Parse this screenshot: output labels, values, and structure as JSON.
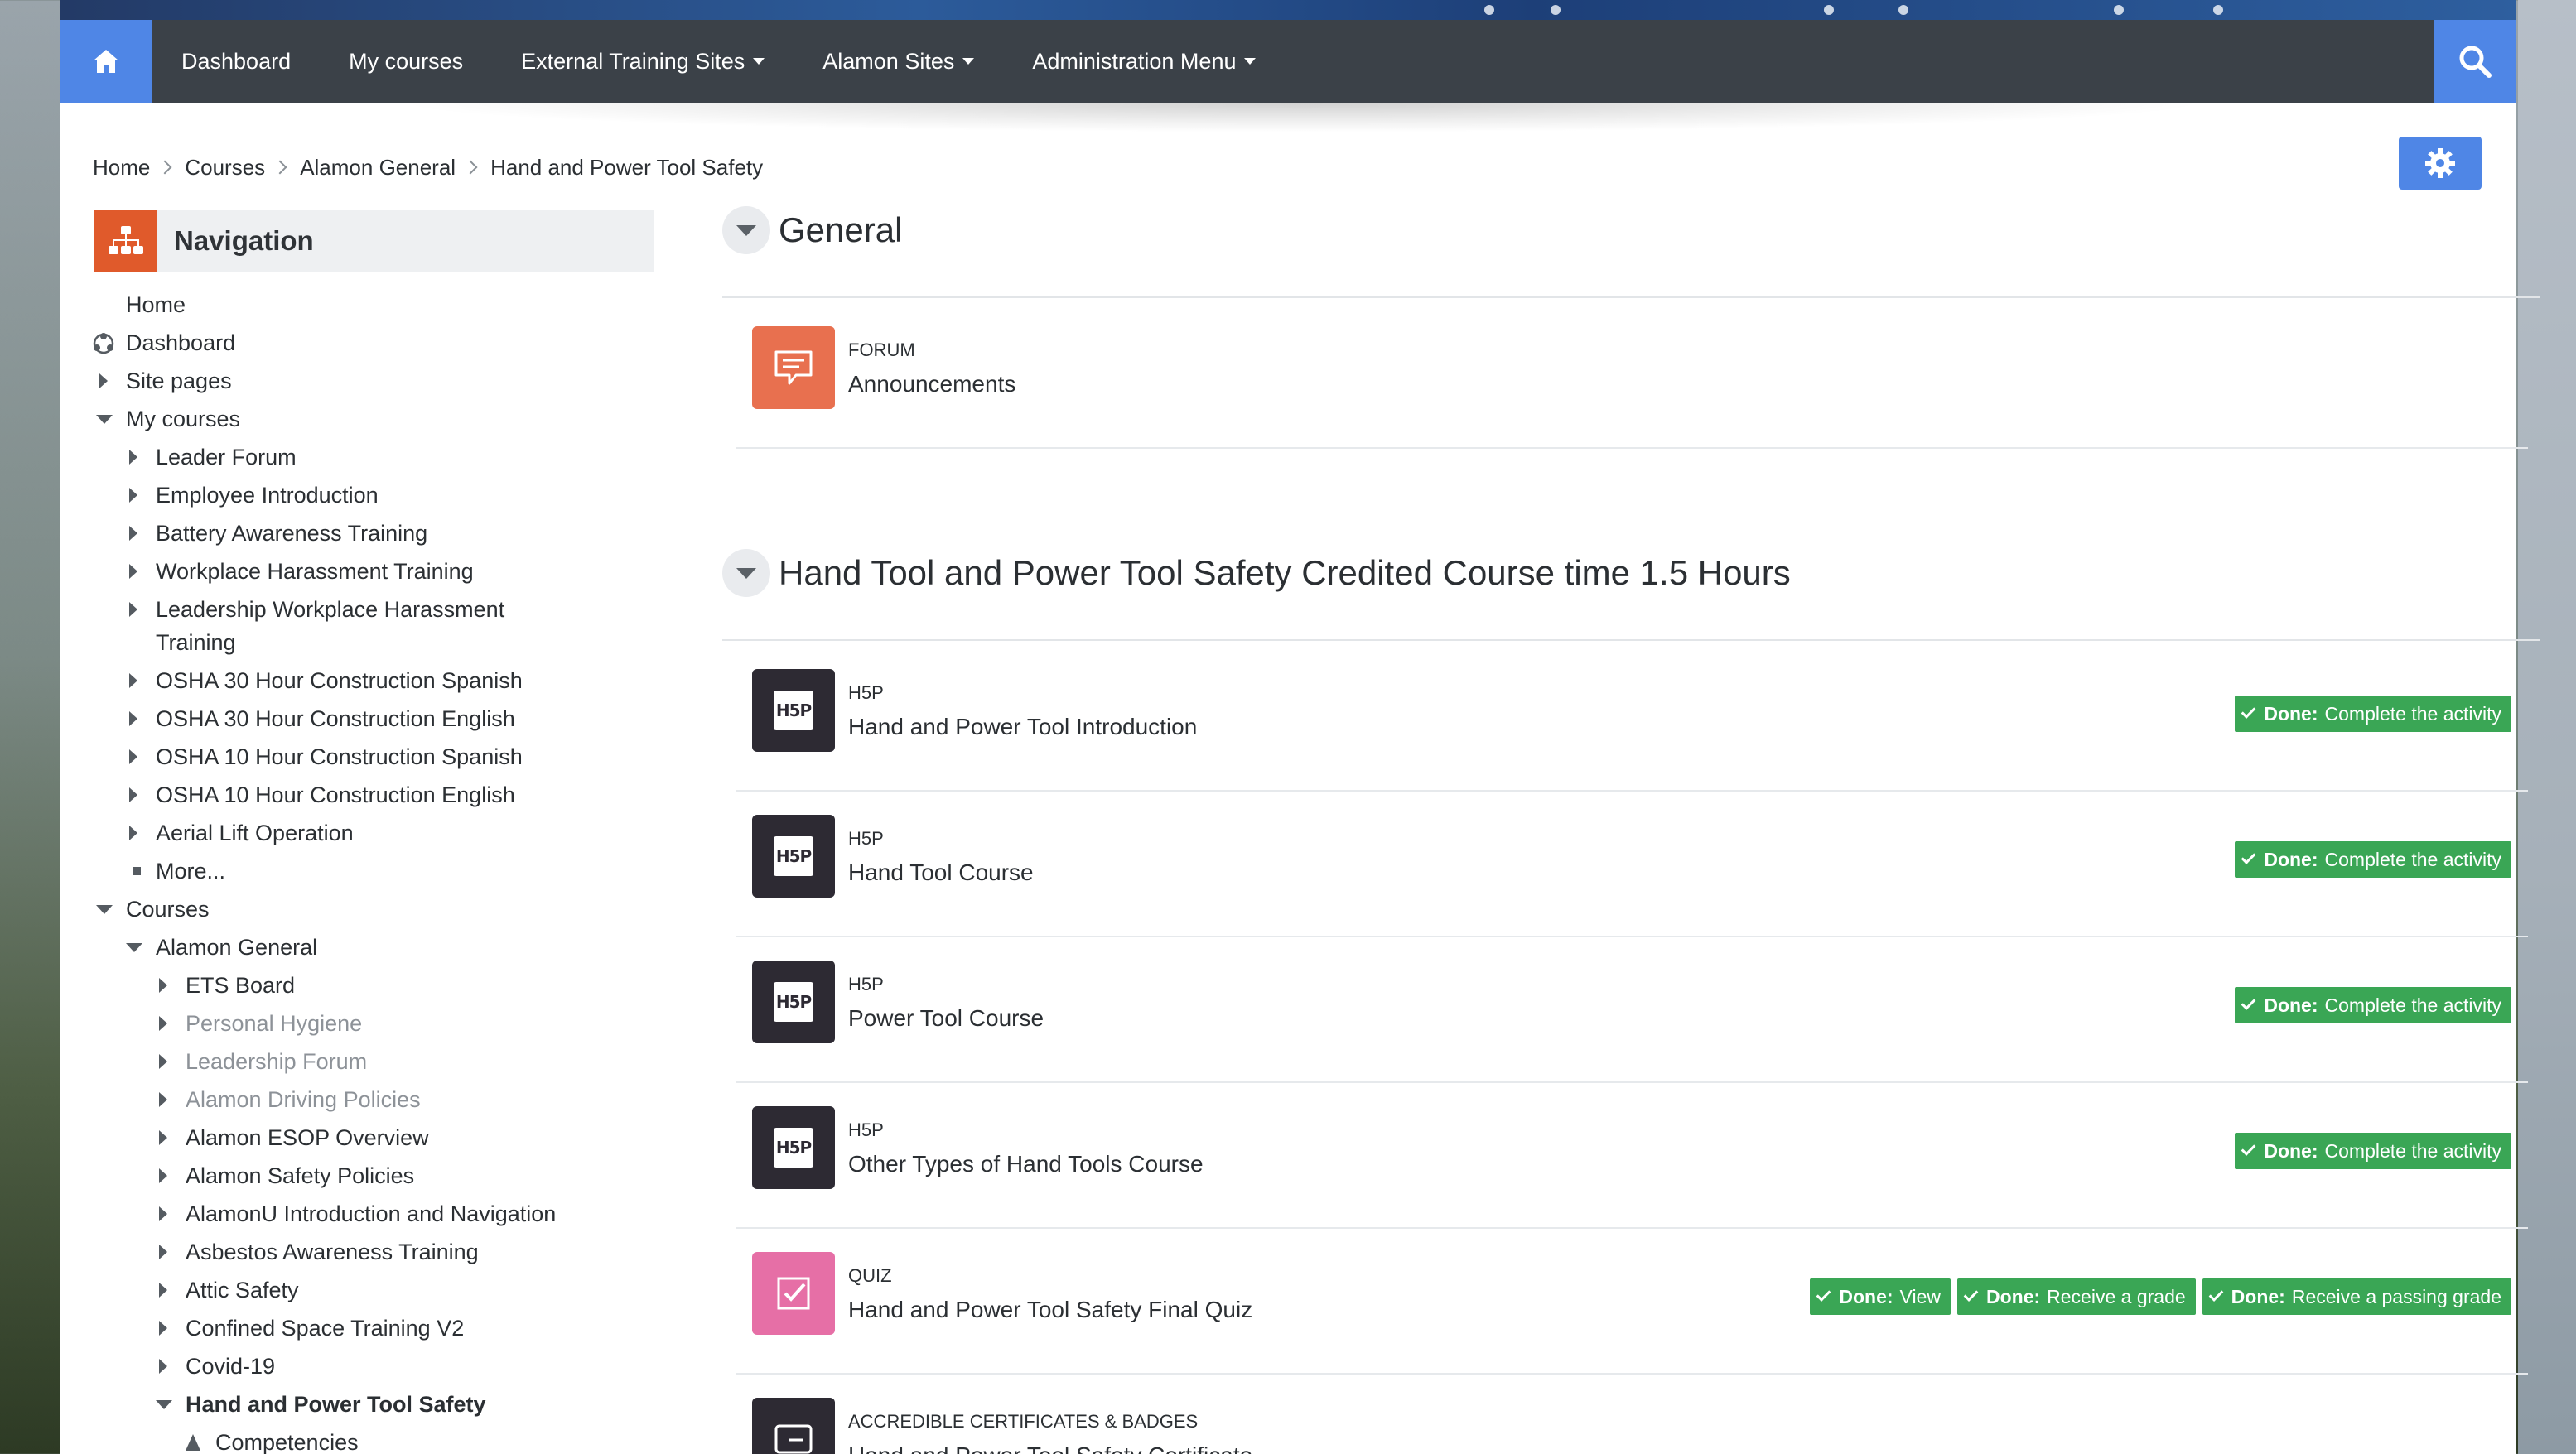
{
  "topnav": {
    "items": [
      {
        "label": "Dashboard",
        "dropdown": false
      },
      {
        "label": "My courses",
        "dropdown": false
      },
      {
        "label": "External Training Sites",
        "dropdown": true
      },
      {
        "label": "Alamon Sites",
        "dropdown": true
      },
      {
        "label": "Administration Menu",
        "dropdown": true
      }
    ]
  },
  "breadcrumb": [
    "Home",
    "Courses",
    "Alamon General",
    "Hand and Power Tool Safety"
  ],
  "navigation": {
    "title": "Navigation",
    "tree": [
      {
        "label": "Home",
        "depth": 0,
        "marker": "none",
        "style": "normal"
      },
      {
        "label": "Dashboard",
        "depth": 0,
        "marker": "icon",
        "style": "normal"
      },
      {
        "label": "Site pages",
        "depth": 0,
        "marker": "collapsed",
        "style": "normal"
      },
      {
        "label": "My courses",
        "depth": 0,
        "marker": "expanded",
        "style": "normal"
      },
      {
        "label": "Leader Forum",
        "depth": 1,
        "marker": "collapsed",
        "style": "normal"
      },
      {
        "label": "Employee Introduction",
        "depth": 1,
        "marker": "collapsed",
        "style": "normal"
      },
      {
        "label": "Battery Awareness Training",
        "depth": 1,
        "marker": "collapsed",
        "style": "normal"
      },
      {
        "label": "Workplace Harassment Training",
        "depth": 1,
        "marker": "collapsed",
        "style": "normal"
      },
      {
        "label": "Leadership Workplace Harassment",
        "label2": "Training",
        "depth": 1,
        "marker": "collapsed",
        "style": "normal"
      },
      {
        "label": "OSHA 30 Hour Construction Spanish",
        "depth": 1,
        "marker": "collapsed",
        "style": "normal"
      },
      {
        "label": "OSHA 30 Hour Construction English",
        "depth": 1,
        "marker": "collapsed",
        "style": "normal"
      },
      {
        "label": "OSHA 10 Hour Construction Spanish",
        "depth": 1,
        "marker": "collapsed",
        "style": "normal"
      },
      {
        "label": "OSHA 10 Hour Construction English",
        "depth": 1,
        "marker": "collapsed",
        "style": "normal"
      },
      {
        "label": "Aerial Lift Operation",
        "depth": 1,
        "marker": "collapsed",
        "style": "normal"
      },
      {
        "label": "More...",
        "depth": 1,
        "marker": "square",
        "style": "normal"
      },
      {
        "label": "Courses",
        "depth": 0,
        "marker": "expanded",
        "style": "normal"
      },
      {
        "label": "Alamon General",
        "depth": 1,
        "marker": "expanded",
        "style": "normal"
      },
      {
        "label": "ETS Board",
        "depth": 2,
        "marker": "collapsed",
        "style": "normal"
      },
      {
        "label": "Personal Hygiene",
        "depth": 2,
        "marker": "collapsed",
        "style": "dim"
      },
      {
        "label": "Leadership Forum",
        "depth": 2,
        "marker": "collapsed",
        "style": "dim"
      },
      {
        "label": "Alamon Driving Policies",
        "depth": 2,
        "marker": "collapsed",
        "style": "dim"
      },
      {
        "label": "Alamon ESOP Overview",
        "depth": 2,
        "marker": "collapsed",
        "style": "normal"
      },
      {
        "label": "Alamon Safety Policies",
        "depth": 2,
        "marker": "collapsed",
        "style": "normal"
      },
      {
        "label": "AlamonU Introduction and Navigation",
        "depth": 2,
        "marker": "collapsed",
        "style": "normal"
      },
      {
        "label": "Asbestos Awareness Training",
        "depth": 2,
        "marker": "collapsed",
        "style": "normal"
      },
      {
        "label": "Attic Safety",
        "depth": 2,
        "marker": "collapsed",
        "style": "normal"
      },
      {
        "label": "Confined Space Training V2",
        "depth": 2,
        "marker": "collapsed",
        "style": "normal"
      },
      {
        "label": "Covid-19",
        "depth": 2,
        "marker": "collapsed",
        "style": "normal"
      },
      {
        "label": "Hand and Power Tool Safety",
        "depth": 2,
        "marker": "expanded",
        "style": "bold"
      },
      {
        "label": "Competencies",
        "depth": 3,
        "marker": "icon",
        "style": "normal"
      }
    ]
  },
  "sections": [
    {
      "title": "General",
      "activities": [
        {
          "type": "FORUM",
          "name": "Announcements",
          "icon": "forum-icon",
          "color": "#e8704f",
          "chips": []
        }
      ]
    },
    {
      "title": "Hand Tool and Power Tool Safety Credited Course time 1.5 Hours",
      "activities": [
        {
          "type": "H5P",
          "name": "Hand and Power Tool Introduction",
          "icon": "h5p-icon",
          "color": "#2d2a33",
          "chips": [
            {
              "strong": "Done:",
              "text": "Complete the activity"
            }
          ]
        },
        {
          "type": "H5P",
          "name": "Hand Tool Course",
          "icon": "h5p-icon",
          "color": "#2d2a33",
          "chips": [
            {
              "strong": "Done:",
              "text": "Complete the activity"
            }
          ]
        },
        {
          "type": "H5P",
          "name": "Power Tool Course",
          "icon": "h5p-icon",
          "color": "#2d2a33",
          "chips": [
            {
              "strong": "Done:",
              "text": "Complete the activity"
            }
          ]
        },
        {
          "type": "H5P",
          "name": "Other Types of Hand Tools Course",
          "icon": "h5p-icon",
          "color": "#2d2a33",
          "chips": [
            {
              "strong": "Done:",
              "text": "Complete the activity"
            }
          ]
        },
        {
          "type": "QUIZ",
          "name": "Hand and Power Tool Safety Final Quiz",
          "icon": "quiz-icon",
          "color": "#e66fa6",
          "chips": [
            {
              "strong": "Done:",
              "text": "View"
            },
            {
              "strong": "Done:",
              "text": "Receive a grade"
            },
            {
              "strong": "Done:",
              "text": "Receive a passing grade"
            }
          ]
        },
        {
          "type": "ACCREDIBLE CERTIFICATES & BADGES",
          "name": "Hand and Power Tool Safety Certificate",
          "icon": "certificate-icon",
          "color": "#2d2a33",
          "chips": []
        }
      ]
    }
  ],
  "h5p_icon_text": "H5P",
  "colors": {
    "nav_bg": "#3b4148",
    "accent": "#4f86e6",
    "done_green": "#3aa655",
    "nav_badge": "#e05a2b"
  }
}
